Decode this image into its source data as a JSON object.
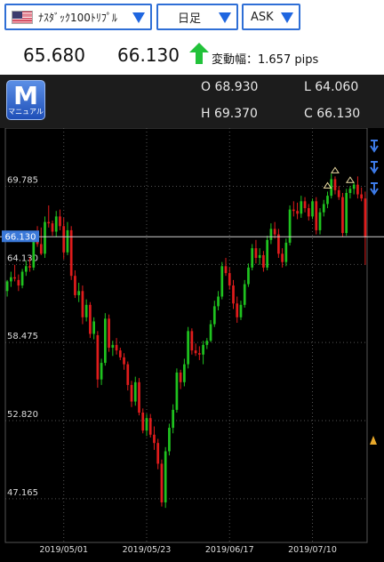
{
  "instrument_select": {
    "label": "ﾅｽﾀﾞｯｸ100ﾄﾘﾌﾟﾙ",
    "flag_icon": "us-flag-icon"
  },
  "period_select": {
    "label": "日足"
  },
  "side_select": {
    "label": "ASK"
  },
  "quote": {
    "bid": "65.680",
    "ask": "66.130",
    "change_label": "変動幅：1.657 pips",
    "arrow_icon": "up-arrow-icon",
    "arrow_color": "#22c23a"
  },
  "ohlc": {
    "open": "O 68.930",
    "low": "L 64.060",
    "high": "H 69.370",
    "close": "C 66.130"
  },
  "menu_button": {
    "letter": "M",
    "caption": "マニュアル"
  },
  "chart_data": {
    "type": "candlestick",
    "y_ticks": [
      "69.785",
      "64.130",
      "58.475",
      "52.820",
      "47.165"
    ],
    "y_tick_values": [
      69.785,
      64.13,
      58.475,
      52.82,
      47.165
    ],
    "current_price_label": "66.130",
    "current_price": 66.13,
    "x_ticks": [
      "2019/05/01",
      "2019/05/23",
      "2019/06/17",
      "2019/07/10"
    ],
    "x_tick_index": [
      15,
      37,
      59,
      81
    ],
    "ylim": [
      44.0,
      74.0
    ],
    "up_color": "#1fc21f",
    "down_color": "#e01c1c",
    "grid": "dotted",
    "candles": [
      [
        62.2,
        63.0,
        61.8,
        62.9
      ],
      [
        62.9,
        63.6,
        62.5,
        63.2
      ],
      [
        63.2,
        64.1,
        62.9,
        63.1
      ],
      [
        63.0,
        63.4,
        62.2,
        62.6
      ],
      [
        62.6,
        63.8,
        62.4,
        63.6
      ],
      [
        63.6,
        64.4,
        63.3,
        64.0
      ],
      [
        64.0,
        64.6,
        63.6,
        63.9
      ],
      [
        63.9,
        66.4,
        63.7,
        66.1
      ],
      [
        66.1,
        66.9,
        65.4,
        65.6
      ],
      [
        65.6,
        66.8,
        64.8,
        64.9
      ],
      [
        64.9,
        67.6,
        64.6,
        67.2
      ],
      [
        67.2,
        68.4,
        66.8,
        67.1
      ],
      [
        67.1,
        67.3,
        66.2,
        66.5
      ],
      [
        66.5,
        68.0,
        66.1,
        67.6
      ],
      [
        67.6,
        68.1,
        66.6,
        66.9
      ],
      [
        66.9,
        67.5,
        64.5,
        65.0
      ],
      [
        65.0,
        67.2,
        64.8,
        66.6
      ],
      [
        66.6,
        66.9,
        63.0,
        63.3
      ],
      [
        63.3,
        63.7,
        61.7,
        61.9
      ],
      [
        61.9,
        62.8,
        61.4,
        62.2
      ],
      [
        62.2,
        62.6,
        59.8,
        60.3
      ],
      [
        60.3,
        61.6,
        60.0,
        61.2
      ],
      [
        61.2,
        61.4,
        58.8,
        59.1
      ],
      [
        59.1,
        60.3,
        58.7,
        60.0
      ],
      [
        59.0,
        59.3,
        55.2,
        55.8
      ],
      [
        55.8,
        57.3,
        55.4,
        57.0
      ],
      [
        57.0,
        60.6,
        56.8,
        60.2
      ],
      [
        60.2,
        60.5,
        57.8,
        58.1
      ],
      [
        58.1,
        58.6,
        57.5,
        58.3
      ],
      [
        58.3,
        58.8,
        57.6,
        57.9
      ],
      [
        57.9,
        58.1,
        57.2,
        57.4
      ],
      [
        57.4,
        57.7,
        56.5,
        56.9
      ],
      [
        56.9,
        57.1,
        55.0,
        55.4
      ],
      [
        55.4,
        55.7,
        53.8,
        54.2
      ],
      [
        54.2,
        56.0,
        53.9,
        55.6
      ],
      [
        55.6,
        55.9,
        53.2,
        53.4
      ],
      [
        53.4,
        53.7,
        51.9,
        52.1
      ],
      [
        52.1,
        53.3,
        51.7,
        53.0
      ],
      [
        53.0,
        53.3,
        51.6,
        51.8
      ],
      [
        51.8,
        52.4,
        50.7,
        51.2
      ],
      [
        51.2,
        51.5,
        49.3,
        49.7
      ],
      [
        49.7,
        50.0,
        46.6,
        46.9
      ],
      [
        46.9,
        50.9,
        46.5,
        50.6
      ],
      [
        50.6,
        52.6,
        50.3,
        52.3
      ],
      [
        52.3,
        54.0,
        51.9,
        53.6
      ],
      [
        53.6,
        56.6,
        53.4,
        56.3
      ],
      [
        56.3,
        56.5,
        55.1,
        55.6
      ],
      [
        55.6,
        57.3,
        55.3,
        56.9
      ],
      [
        56.9,
        59.6,
        56.6,
        59.3
      ],
      [
        59.3,
        59.5,
        57.6,
        57.9
      ],
      [
        57.9,
        58.4,
        57.5,
        57.7
      ],
      [
        57.7,
        58.2,
        57.2,
        57.6
      ],
      [
        57.6,
        58.6,
        56.9,
        58.3
      ],
      [
        58.3,
        58.8,
        58.0,
        58.6
      ],
      [
        58.6,
        60.1,
        58.5,
        59.8
      ],
      [
        59.8,
        61.5,
        59.6,
        61.1
      ],
      [
        61.1,
        62.2,
        60.8,
        61.8
      ],
      [
        61.8,
        64.3,
        61.6,
        64.0
      ],
      [
        64.0,
        64.6,
        63.3,
        63.5
      ],
      [
        63.5,
        63.9,
        62.3,
        62.6
      ],
      [
        62.6,
        63.0,
        60.9,
        61.3
      ],
      [
        61.3,
        61.8,
        59.9,
        60.3
      ],
      [
        60.3,
        61.5,
        60.1,
        61.2
      ],
      [
        61.2,
        63.0,
        61.0,
        62.7
      ],
      [
        62.7,
        64.2,
        62.5,
        63.9
      ],
      [
        63.9,
        65.6,
        63.7,
        65.3
      ],
      [
        65.3,
        65.9,
        64.2,
        64.6
      ],
      [
        64.6,
        65.3,
        64.1,
        64.8
      ],
      [
        64.8,
        65.1,
        63.6,
        63.9
      ],
      [
        63.9,
        66.2,
        63.7,
        65.9
      ],
      [
        65.9,
        67.1,
        65.6,
        66.7
      ],
      [
        66.7,
        67.2,
        66.0,
        66.3
      ],
      [
        66.3,
        66.7,
        64.6,
        64.9
      ],
      [
        64.9,
        65.3,
        63.9,
        64.3
      ],
      [
        64.3,
        66.0,
        64.0,
        65.7
      ],
      [
        65.7,
        68.4,
        65.5,
        68.1
      ],
      [
        68.1,
        68.7,
        67.6,
        68.0
      ],
      [
        68.0,
        68.6,
        67.4,
        67.8
      ],
      [
        67.8,
        69.1,
        67.5,
        68.7
      ],
      [
        68.7,
        69.0,
        67.9,
        68.2
      ],
      [
        68.2,
        68.5,
        67.3,
        67.6
      ],
      [
        67.6,
        68.9,
        67.4,
        68.7
      ],
      [
        68.7,
        69.0,
        66.3,
        66.6
      ],
      [
        66.6,
        68.2,
        66.3,
        67.9
      ],
      [
        67.9,
        68.8,
        67.6,
        68.5
      ],
      [
        68.5,
        69.4,
        68.2,
        69.1
      ],
      [
        69.1,
        70.7,
        68.9,
        70.3
      ],
      [
        70.3,
        70.5,
        69.2,
        69.5
      ],
      [
        69.5,
        69.8,
        68.8,
        69.0
      ],
      [
        69.0,
        69.3,
        66.1,
        66.4
      ],
      [
        66.4,
        69.6,
        66.2,
        69.3
      ],
      [
        69.3,
        69.8,
        68.9,
        69.6
      ],
      [
        69.6,
        70.1,
        69.2,
        69.9
      ],
      [
        69.9,
        70.5,
        68.9,
        69.2
      ],
      [
        69.2,
        69.7,
        68.7,
        68.9
      ],
      [
        68.9,
        69.4,
        64.1,
        66.1
      ]
    ]
  },
  "markers": {
    "right_top_icons": "blue-arrow-down-icon",
    "right_bottom_icon": "yellow-arrow-up-icon",
    "peak_marker_icon": "red-triangle-icon"
  }
}
